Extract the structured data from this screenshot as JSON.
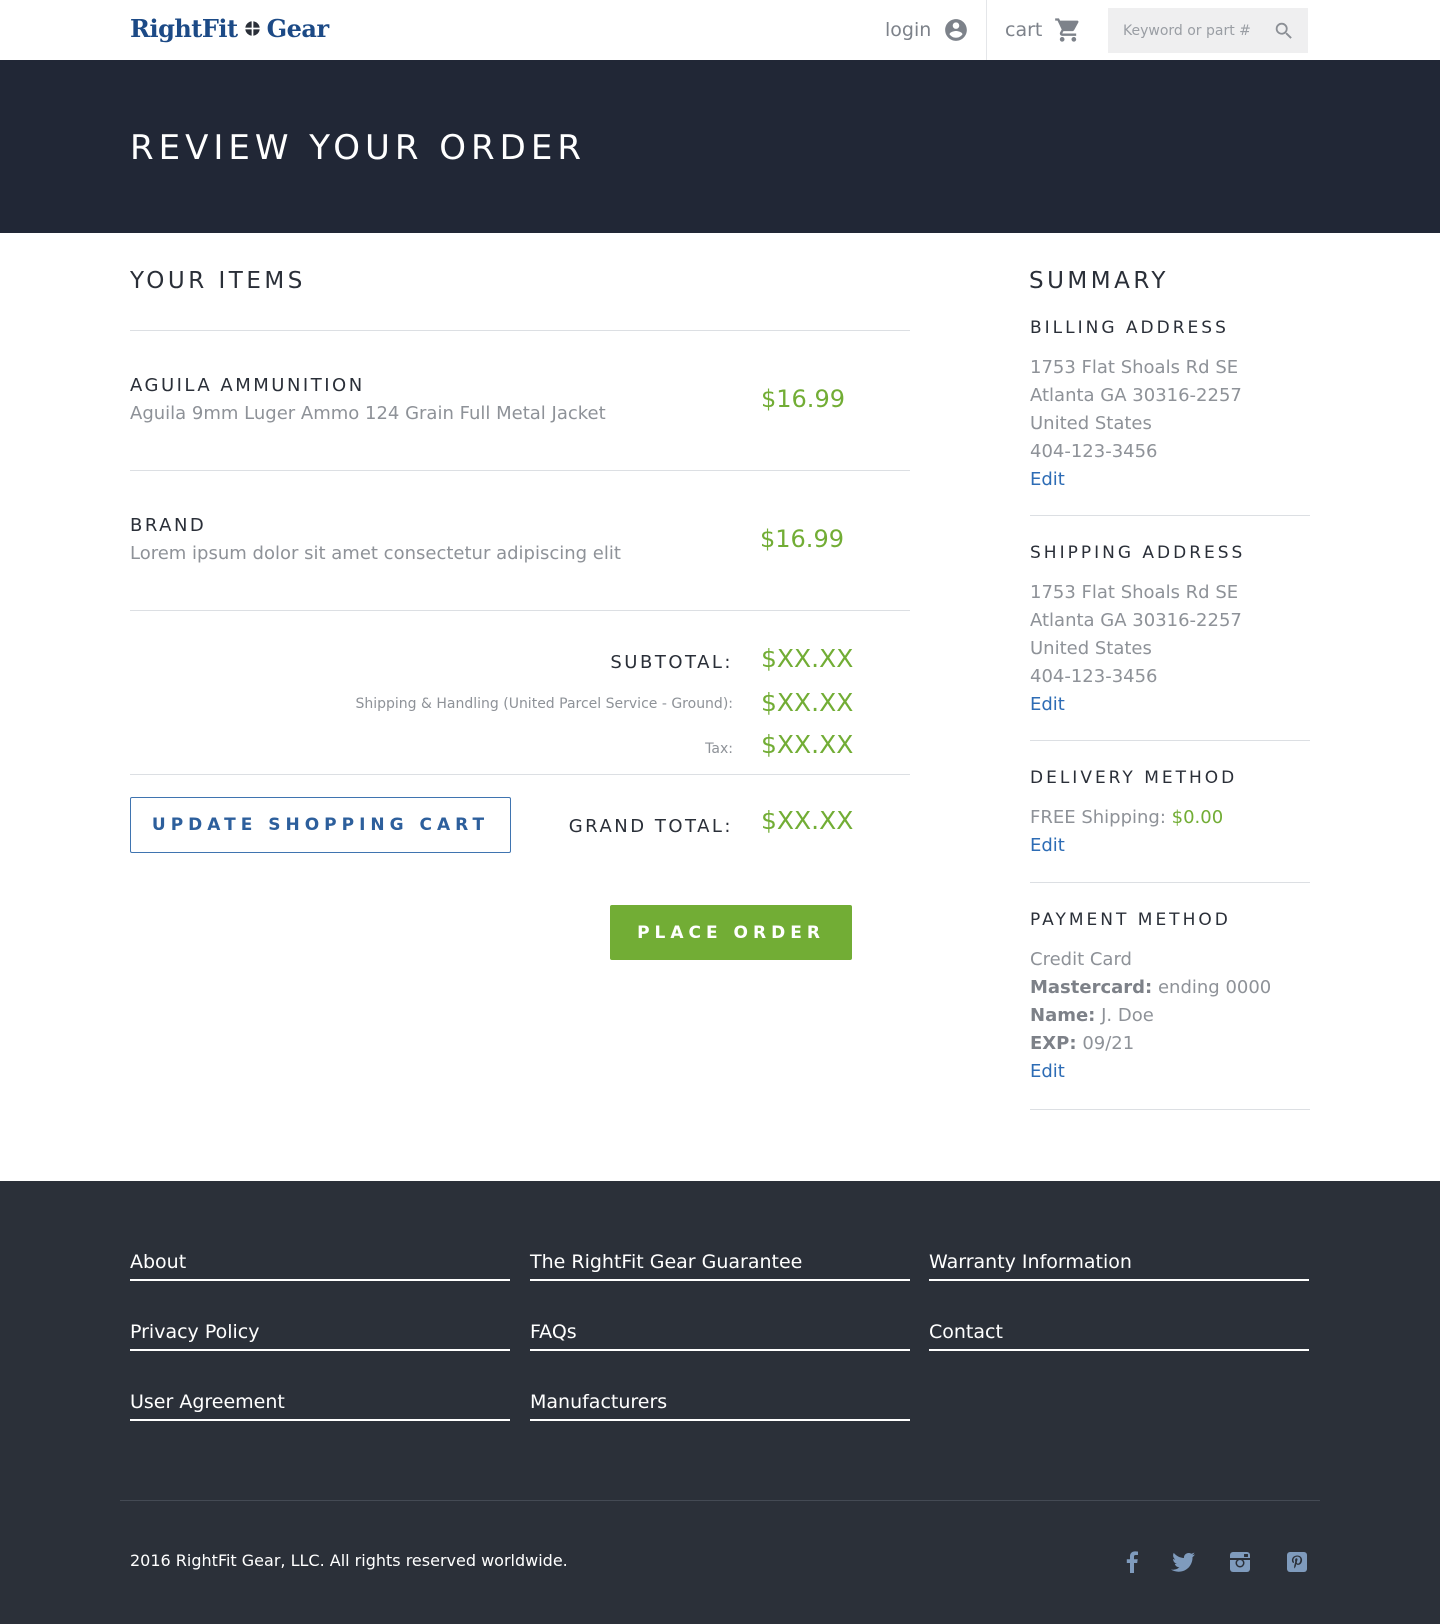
{
  "header": {
    "logo_text_1": "RightFit",
    "logo_text_2": "Gear",
    "login_label": "login",
    "cart_label": "cart",
    "search_placeholder": "Keyword or part #"
  },
  "hero": {
    "title": "REVIEW YOUR ORDER"
  },
  "items_section": {
    "title": "YOUR ITEMS",
    "items": [
      {
        "brand": "AGUILA AMMUNITION",
        "description": "Aguila 9mm Luger Ammo 124 Grain Full Metal Jacket",
        "price": "$16.99"
      },
      {
        "brand": "BRAND",
        "description": "Lorem ipsum dolor sit amet consectetur adipiscing elit",
        "price": "$16.99"
      }
    ]
  },
  "totals": {
    "subtotal_label": "SUBTOTAL:",
    "subtotal_value": "$XX.XX",
    "shipping_label": "Shipping & Handling (United Parcel Service - Ground):",
    "shipping_value": "$XX.XX",
    "tax_label": "Tax:",
    "tax_value": "$XX.XX",
    "grand_total_label": "GRAND TOTAL:",
    "grand_total_value": "$XX.XX"
  },
  "actions": {
    "update_cart_label": "UPDATE SHOPPING CART",
    "place_order_label": "PLACE ORDER"
  },
  "summary": {
    "title": "SUMMARY",
    "billing": {
      "heading": "BILLING ADDRESS",
      "lines": [
        "1753 Flat Shoals Rd SE",
        "Atlanta GA 30316-2257",
        "United States",
        "404-123-3456"
      ],
      "edit_label": "Edit"
    },
    "shipping": {
      "heading": "SHIPPING ADDRESS",
      "lines": [
        "1753 Flat Shoals Rd SE",
        "Atlanta GA 30316-2257",
        "United States",
        "404-123-3456"
      ],
      "edit_label": "Edit"
    },
    "delivery": {
      "heading": "DELIVERY METHOD",
      "method_label": "FREE Shipping:",
      "method_price": "$0.00",
      "edit_label": "Edit"
    },
    "payment": {
      "heading": "PAYMENT METHOD",
      "type": "Credit Card",
      "card_label": "Mastercard:",
      "card_value": "ending 0000",
      "name_label": "Name:",
      "name_value": "J. Doe",
      "exp_label": "EXP:",
      "exp_value": "09/21",
      "edit_label": "Edit"
    }
  },
  "footer": {
    "links": [
      "About",
      "The RightFit Gear Guarantee",
      "Warranty Information",
      "Privacy Policy",
      "FAQs",
      "Contact",
      "User Agreement",
      "Manufacturers"
    ],
    "copyright": "2016 RightFit Gear, LLC. All rights reserved worldwide.",
    "social_icons": [
      "facebook-icon",
      "twitter-icon",
      "instagram-icon",
      "pinterest-icon"
    ]
  },
  "colors": {
    "brand_blue": "#1c4a86",
    "hero_bg": "#212736",
    "price_green": "#72ad35",
    "link_blue": "#2d6cb5",
    "footer_bg": "#2b3039",
    "social_icon": "#7f9bbd"
  }
}
